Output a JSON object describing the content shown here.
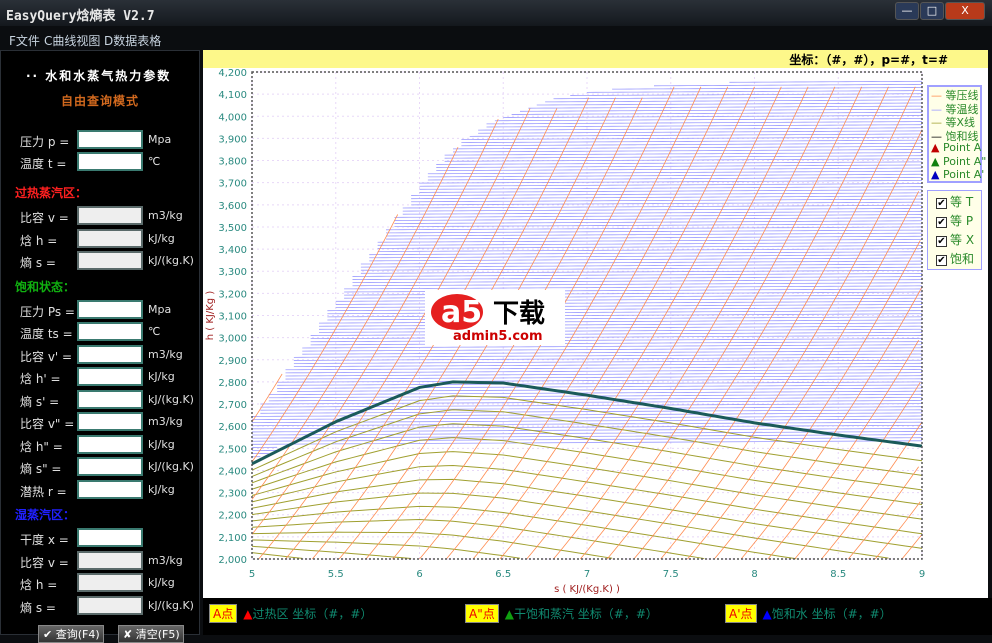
{
  "window": {
    "title": "EasyQuery焓熵表 V2.7",
    "min": "—",
    "max": "□",
    "close": "X"
  },
  "menu": [
    "F文件",
    "C曲线视图",
    "D数据表格"
  ],
  "left": {
    "title": "·· 水和水蒸气热力参数",
    "mode": "自由查询模式",
    "inputs": [
      {
        "label": "压力 p =",
        "unit": "Mpa"
      },
      {
        "label": "温度 t =",
        "unit": "℃"
      }
    ],
    "sections": [
      {
        "title": "过热蒸汽区：",
        "color": "#ff2020",
        "rows": [
          {
            "label": "比容 v =",
            "unit": "m3/kg"
          },
          {
            "label": "焓   h =",
            "unit": "kJ/kg"
          },
          {
            "label": "熵   s =",
            "unit": "kJ/(kg.K)"
          }
        ]
      },
      {
        "title": "饱和状态：",
        "color": "#10b010",
        "rows": [
          {
            "label": "压力 Ps =",
            "unit": "Mpa"
          },
          {
            "label": "温度 ts =",
            "unit": "℃"
          },
          {
            "label": "比容 v' =",
            "unit": "m3/kg"
          },
          {
            "label": "焓   h' =",
            "unit": "kJ/kg"
          },
          {
            "label": "熵   s' =",
            "unit": "kJ/(kg.K)"
          },
          {
            "label": "比容 v\" =",
            "unit": "m3/kg"
          },
          {
            "label": "焓   h\" =",
            "unit": "kJ/kg"
          },
          {
            "label": "熵   s\" =",
            "unit": "kJ/(kg.K)"
          },
          {
            "label": "潜热 r =",
            "unit": "kJ/kg"
          }
        ]
      },
      {
        "title": "湿蒸汽区：",
        "color": "#2020ff",
        "rows": [
          {
            "label": "干度 x =",
            "unit": ""
          },
          {
            "label": "比容 v =",
            "unit": "m3/kg"
          },
          {
            "label": "焓   h =",
            "unit": "kJ/kg"
          },
          {
            "label": "熵   s =",
            "unit": "kJ/(kg.K)"
          }
        ]
      }
    ],
    "buttons": {
      "query": "✔ 查询(F4)",
      "clear": "✘ 清空(F5)"
    }
  },
  "coord": "坐标：（#，#），p=#，t=#",
  "legend": [
    {
      "label": "等压线",
      "color": "#ff8c50",
      "mark": "—"
    },
    {
      "label": "等温线",
      "color": "#9a9aff",
      "mark": "—"
    },
    {
      "label": "等X线",
      "color": "#a0a030",
      "mark": "—"
    },
    {
      "label": "饱和线",
      "color": "#000000",
      "mark": "—"
    },
    {
      "label": "Point A",
      "color": "#c00000",
      "mark": "▲"
    },
    {
      "label": "Point A\"",
      "color": "#108010",
      "mark": "▲"
    },
    {
      "label": "Point A'",
      "color": "#0000c0",
      "mark": "▲"
    }
  ],
  "toggles": [
    {
      "label": "等 T",
      "checked": true
    },
    {
      "label": "等 P",
      "checked": true
    },
    {
      "label": "等 X",
      "checked": true
    },
    {
      "label": "饱和",
      "checked": true
    }
  ],
  "watermark": {
    "logo": "a5下载",
    "url": "admin5.com"
  },
  "points": [
    {
      "box": "A点",
      "mark": "▲",
      "mark_color": "#ff0000",
      "text": "过热区 坐标（#，#）"
    },
    {
      "box": "A\"点",
      "mark": "▲",
      "mark_color": "#10a010",
      "text": "干饱和蒸汽 坐标（#，#）"
    },
    {
      "box": "A'点",
      "mark": "▲",
      "mark_color": "#0000ff",
      "text": "饱和水 坐标（#，#）"
    }
  ],
  "chart_data": {
    "type": "line",
    "title": "",
    "xlabel": "s ( KJ/(Kg.K) )",
    "ylabel": "h ( KJ/Kg )",
    "xlim": [
      5,
      9
    ],
    "ylim": [
      2000,
      4200
    ],
    "xticks": [
      "5",
      "5.5",
      "6",
      "6.5",
      "7",
      "7.5",
      "8",
      "8.5",
      "9"
    ],
    "yticks": [
      "2,000",
      "2,100",
      "2,200",
      "2,300",
      "2,400",
      "2,500",
      "2,600",
      "2,700",
      "2,800",
      "2,900",
      "3,000",
      "3,100",
      "3,200",
      "3,300",
      "3,400",
      "3,500",
      "3,600",
      "3,700",
      "3,800",
      "3,900",
      "4,000",
      "4,100",
      "4,200"
    ],
    "saturation": {
      "s": [
        5,
        5.5,
        6,
        6.2,
        6.5,
        7,
        7.5,
        8,
        8.5,
        9
      ],
      "h": [
        2430,
        2620,
        2775,
        2800,
        2795,
        2740,
        2680,
        2615,
        2560,
        2510
      ]
    },
    "colors": {
      "isobar": "#ff8c50",
      "isotherm": "#9a9aff",
      "quality": "#a0a030",
      "saturation": "#1a5a5a"
    }
  }
}
